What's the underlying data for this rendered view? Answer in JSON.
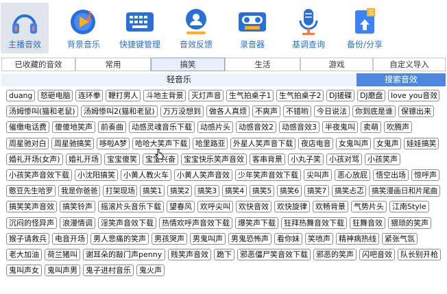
{
  "toolbar": {
    "items": [
      {
        "label": "主播音效",
        "icon": "headphones-icon",
        "active": true
      },
      {
        "label": "背景音乐",
        "icon": "music-disc-icon"
      },
      {
        "label": "快捷键管理",
        "icon": "keyboard-icon"
      },
      {
        "label": "音效反馈",
        "icon": "feedback-icon"
      },
      {
        "label": "录音器",
        "icon": "cassette-icon"
      },
      {
        "label": "基调查询",
        "icon": "microphone-icon"
      },
      {
        "label": "备份/分享",
        "icon": "backup-icon"
      }
    ]
  },
  "tabs": [
    "已收藏的音效",
    "常用",
    "搞笑",
    "生活",
    "游戏",
    "自定义导入"
  ],
  "active_tab": "搞笑",
  "subtabs": {
    "light": "轻音乐",
    "search": "搜索音效"
  },
  "rows": [
    [
      "duang",
      "怒砸电脑",
      "连环拳",
      "鞭打男人",
      "斗地主背景",
      "灭灯声音",
      "生气拍桌子1",
      "生气拍桌子2",
      "DJ搓碟",
      "DJ磨盘",
      "love you音效"
    ],
    [
      "汤姆惨叫(猫和老鼠)",
      "汤姆惨叫2(猫和老鼠)",
      "万万没想到",
      "做各人真烦",
      "不爽声",
      "不错哟",
      "今日说法",
      "你到底是谁",
      "保镖出来"
    ],
    [
      "催缴电话费",
      "傻傻地笑声",
      "前奏曲",
      "动感灵魂音乐下载",
      "动感片头",
      "动感音效2",
      "动感音效3",
      "半夜鬼叫",
      "卖萌",
      "吹腾声"
    ],
    [
      "周星驰对白",
      "周星驰搞笑",
      "哆啦A梦",
      "哈哈大笑声下载",
      "哈里路亚",
      "外星人笑声音下载",
      "夜店电音",
      "女鬼叫声",
      "女鬼声",
      "娃娃搞笑"
    ],
    [
      "婚礼开场(女声)",
      "婚礼开场",
      "宝宝傻笑",
      "宝宝兴奋",
      "宝宝快乐笑声音效",
      "客串背景",
      "小丸子笑",
      "小孩对骂",
      "小孩笑声"
    ],
    [
      "小孩笑声音效下载",
      "小沈阳搞笑",
      "小黄人教火车",
      "小黄人笑声音效",
      "少年笑声音效下载",
      "尖叫声",
      "恶心放屁",
      "悟空出场",
      "惊呼声"
    ],
    [
      "憨豆先生哈罗",
      "我是你爸爸",
      "打架现场",
      "搞笑1",
      "搞笑2",
      "搞笑3",
      "搞笑4",
      "搞笑5",
      "搞笑6",
      "搞笑7",
      "搞笑忐忑",
      "搞笑漫画日和片尾曲"
    ],
    [
      "搞笑笑声音效",
      "搞笑铃声",
      "摇滚片头音乐下载",
      "望春风",
      "欢呼尖叫",
      "欢快音效",
      "欢快旋律",
      "欢畅背景",
      "气势片头",
      "江南Style"
    ],
    [
      "沉闷的怪异声",
      "浪漫情调",
      "淫笑声音效下载",
      "热情欢呼声音效下载",
      "爆笑声下载",
      "狂拜热舞音效下载",
      "狂舞音效",
      "猥琐的笑声"
    ],
    [
      "猴子请救兵",
      "电音开场",
      "男人悲痛的笑声",
      "男孩哭声",
      "男鬼叫声",
      "男鬼恐怖声",
      "看你妹",
      "笑喷声",
      "精神病热线",
      "紧张气氛"
    ],
    [
      "老大加油",
      "荷兰猪叫",
      "谢耳朵的敲门声penny",
      "贱笑声音效",
      "跪下",
      "邪恶僵尸笑音效下载",
      "邪恶的笑声",
      "闪吧音效",
      "队长别开枪"
    ],
    [
      "鬼叫声女",
      "鬼叫声男",
      "鬼子进村音乐",
      "鬼火声"
    ]
  ],
  "colors": {
    "accent": "#2a6fd6",
    "search_tab": "#4e87e0",
    "active_tool_bg": "#dfe5ea"
  }
}
